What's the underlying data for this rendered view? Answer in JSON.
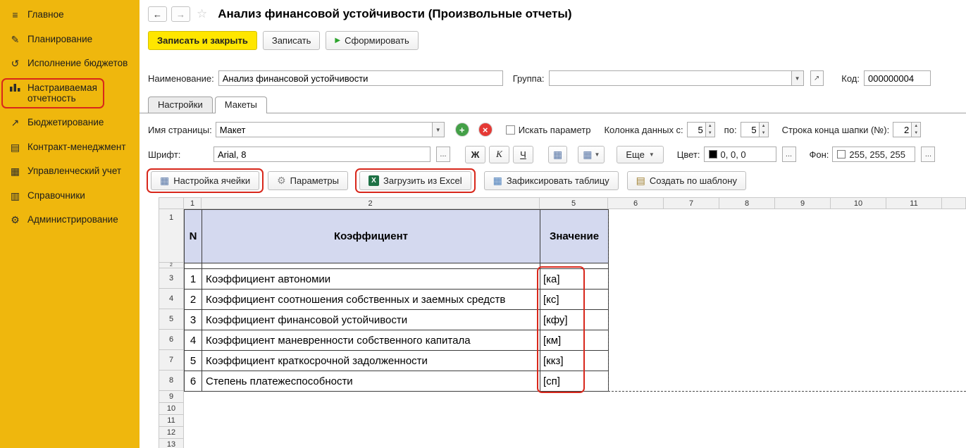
{
  "colors": {
    "sidebar_bg": "#efb70d",
    "primary_button_bg": "#ffe600",
    "annotation_red": "#d8271b",
    "table_header_bg": "#d4d9ef",
    "excel_green": "#1e7145"
  },
  "sidebar": {
    "items": [
      {
        "label": "Главное",
        "icon": "menu-icon"
      },
      {
        "label": "Планирование",
        "icon": "planning-icon"
      },
      {
        "label": "Исполнение бюджетов",
        "icon": "budget-execution-icon"
      },
      {
        "label": "Настраиваемая отчетность",
        "icon": "custom-reports-icon",
        "highlighted": true
      },
      {
        "label": "Бюджетирование",
        "icon": "budgeting-icon"
      },
      {
        "label": "Контракт-менеджмент",
        "icon": "contract-management-icon"
      },
      {
        "label": "Управленческий учет",
        "icon": "management-accounting-icon"
      },
      {
        "label": "Справочники",
        "icon": "catalogs-icon"
      },
      {
        "label": "Администрирование",
        "icon": "administration-icon"
      }
    ]
  },
  "titlebar": {
    "title": "Анализ финансовой устойчивости (Произвольные отчеты)",
    "back": "←",
    "forward": "→",
    "star": "☆"
  },
  "commands": {
    "save_and_close": "Записать и закрыть",
    "save": "Записать",
    "generate": "Сформировать"
  },
  "form": {
    "name_label": "Наименование:",
    "name_value": "Анализ финансовой устойчивости",
    "group_label": "Группа:",
    "group_value": "",
    "code_label": "Код:",
    "code_value": "000000004"
  },
  "tabs": {
    "settings": "Настройки",
    "layouts": "Макеты"
  },
  "page_toolbar": {
    "page_name_label": "Имя страницы:",
    "page_name_value": "Макет",
    "search_param_label": "Искать параметр",
    "data_column_from_label": "Колонка данных с:",
    "data_column_from_value": "5",
    "data_column_to_label": "по:",
    "data_column_to_value": "5",
    "header_end_row_label": "Строка конца шапки (№):",
    "header_end_row_value": "2"
  },
  "format_toolbar": {
    "font_label": "Шрифт:",
    "font_value": "Arial, 8",
    "bold": "Ж",
    "italic": "К",
    "underline": "Ч",
    "more": "Еще",
    "color_label": "Цвет:",
    "color_value": "0, 0, 0",
    "color_hex": "#000000",
    "background_label": "Фон:",
    "background_value": "255, 255, 255",
    "background_hex": "#ffffff",
    "ellipsis": "..."
  },
  "actions_toolbar": {
    "cell_settings": "Настройка ячейки",
    "parameters": "Параметры",
    "load_from_excel": "Загрузить из Excel",
    "fix_table": "Зафиксировать таблицу",
    "create_from_template": "Создать по шаблону"
  },
  "spreadsheet": {
    "column_headers": [
      "1",
      "2",
      "5",
      "6",
      "7",
      "8",
      "9",
      "10",
      "11"
    ],
    "row_numbers": [
      "1",
      "2",
      "3",
      "4",
      "5",
      "6",
      "7",
      "8",
      "9",
      "10",
      "11",
      "12",
      "13"
    ],
    "table_header": {
      "n": "N",
      "coefficient": "Коэффициент",
      "value": "Значение"
    },
    "rows": [
      {
        "n": "1",
        "coefficient": "Коэффициент автономии",
        "value": "[ка]"
      },
      {
        "n": "2",
        "coefficient": "Коэффициент соотношения собственных и заемных средств",
        "value": "[кс]"
      },
      {
        "n": "3",
        "coefficient": "Коэффициент финансовой устойчивости",
        "value": "[кфу]"
      },
      {
        "n": "4",
        "coefficient": "Коэффициент маневренности собственного капитала",
        "value": "[км]"
      },
      {
        "n": "5",
        "coefficient": "Коэффициент краткосрочной задолженности",
        "value": "[ккз]"
      },
      {
        "n": "6",
        "coefficient": "Степень платежеспособности",
        "value": "[сп]"
      }
    ]
  }
}
